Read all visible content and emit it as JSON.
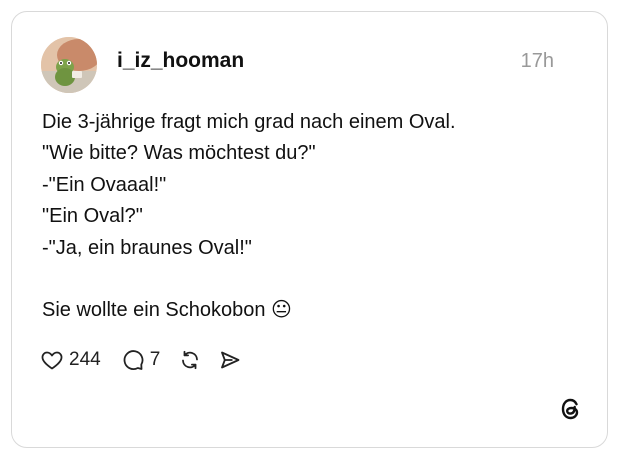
{
  "post": {
    "username": "i_iz_hooman",
    "timestamp": "17h",
    "lines": [
      "Die 3-jährige fragt mich grad nach einem Oval.",
      "\"Wie bitte? Was möchtest du?\"",
      "-\"Ein Ovaaal!\"",
      "\"Ein Oval?\"",
      "-\"Ja, ein braunes Oval!\"",
      "",
      "Sie wollte ein Schokobon 😐"
    ]
  },
  "actions": {
    "like_count": "244",
    "reply_count": "7"
  },
  "icons": {
    "avatar": "frog-avatar",
    "like": "heart-icon",
    "reply": "speech-bubble-icon",
    "repost": "repost-icon",
    "share": "send-icon",
    "brand": "threads-logo-icon"
  }
}
